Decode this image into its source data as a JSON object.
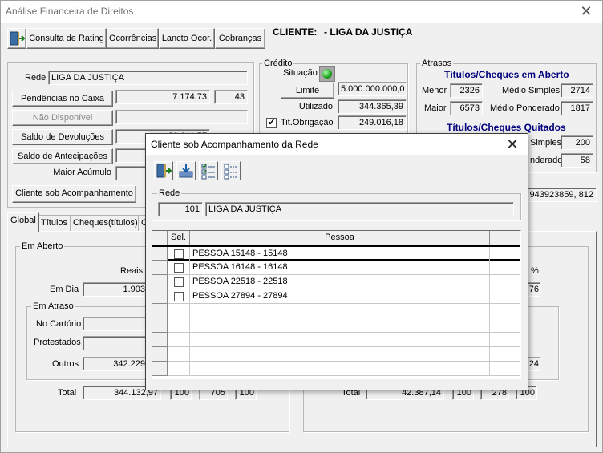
{
  "window": {
    "title": "Análise Financeira de Direitos",
    "close": "✕"
  },
  "toolbar": {
    "exit_icon": "exit-door-icon",
    "consulta_rating": "Consulta de Rating",
    "ocorrencias": "Ocorrências",
    "lancto_ocor": "Lancto Ocor.",
    "cobrancas": "Cobranças"
  },
  "cliente": {
    "label": "CLIENTE:",
    "value": "- LIGA DA JUSTIÇA"
  },
  "left_panel": {
    "rede_label": "Rede",
    "rede_value": "LIGA DA JUSTIÇA",
    "pendencias_button": "Pendências no Caixa",
    "pendencias_value": "7.174,73",
    "pendencias_count": "43",
    "nao_disponivel_button": "Não Disponível",
    "saldo_devolucoes_button": "Saldo de Devoluções",
    "saldo_devolucoes_value": "80.611,57",
    "saldo_antecipacoes_button": "Saldo de Antecipações",
    "maior_acumulo_label": "Maior Acúmulo",
    "cliente_acompanhamento_button": "Cliente sob Acompanhamento"
  },
  "credito": {
    "title": "Crédito",
    "situacao_label": "Situação",
    "limite_button": "Limite",
    "limite_value": "5.000.000.000,0",
    "utilizado_label": "Utilizado",
    "utilizado_value": "344.365,39",
    "tit_obrigacao_label": "Tit.Obrigação",
    "tit_obrigacao_checked": true,
    "tit_obrigacao_value": "249.016,18"
  },
  "atrasos": {
    "title": "Atrasos",
    "aberto_header": "Títulos/Cheques em Aberto",
    "menor_label": "Menor",
    "menor_value": "2326",
    "medio_simples_label": "Médio Simples",
    "medio_simples_value": "2714",
    "maior_label": "Maior",
    "maior_value": "6573",
    "medio_ponderado_label": "Médio Ponderado",
    "medio_ponderado_value": "1817",
    "quitados_header": "Títulos/Cheques Quitados",
    "quitados_simples_label": "Simples",
    "quitados_simples_value": "200",
    "quitados_ponderado_label": "nderado",
    "quitados_ponderado_value": "58",
    "extra_value": "943923859, 812"
  },
  "tabs": [
    "Global",
    "Títulos",
    "Cheques(títulos)",
    "C"
  ],
  "em_aberto": {
    "title": "Em Aberto",
    "reais_label": "Reais (",
    "em_dia_label": "Em Dia",
    "em_dia_value": "1.903",
    "pct_label": "%",
    "pct_value": "76",
    "em_atraso_title": "Em Atraso",
    "no_cartorio_label": "No Cartório",
    "protestados_label": "Protestados",
    "outros_label": "Outros",
    "outros_value": "342.229",
    "outros_right_value": "24",
    "total_label": "Total",
    "total_value": "344.132,97",
    "total_a": "100",
    "total_b": "705",
    "total_c": "100",
    "total2_label": "Total",
    "total2_value": "42.387,14",
    "total2_a": "100",
    "total2_b": "278",
    "total2_c": "100"
  },
  "dialog": {
    "title": "Cliente sob Acompanhamento da Rede",
    "close": "✕",
    "rede_label": "Rede",
    "rede_code": "101",
    "rede_name": "LIGA DA JUSTIÇA",
    "grid": {
      "col_sel": "Sel.",
      "col_pessoa": "Pessoa",
      "rows": [
        {
          "sel": false,
          "pessoa": "PESSOA 15148 - 15148"
        },
        {
          "sel": false,
          "pessoa": "PESSOA 16148 - 16148"
        },
        {
          "sel": false,
          "pessoa": "PESSOA 22518 - 22518"
        },
        {
          "sel": false,
          "pessoa": "PESSOA 27894 - 27894"
        }
      ]
    }
  }
}
